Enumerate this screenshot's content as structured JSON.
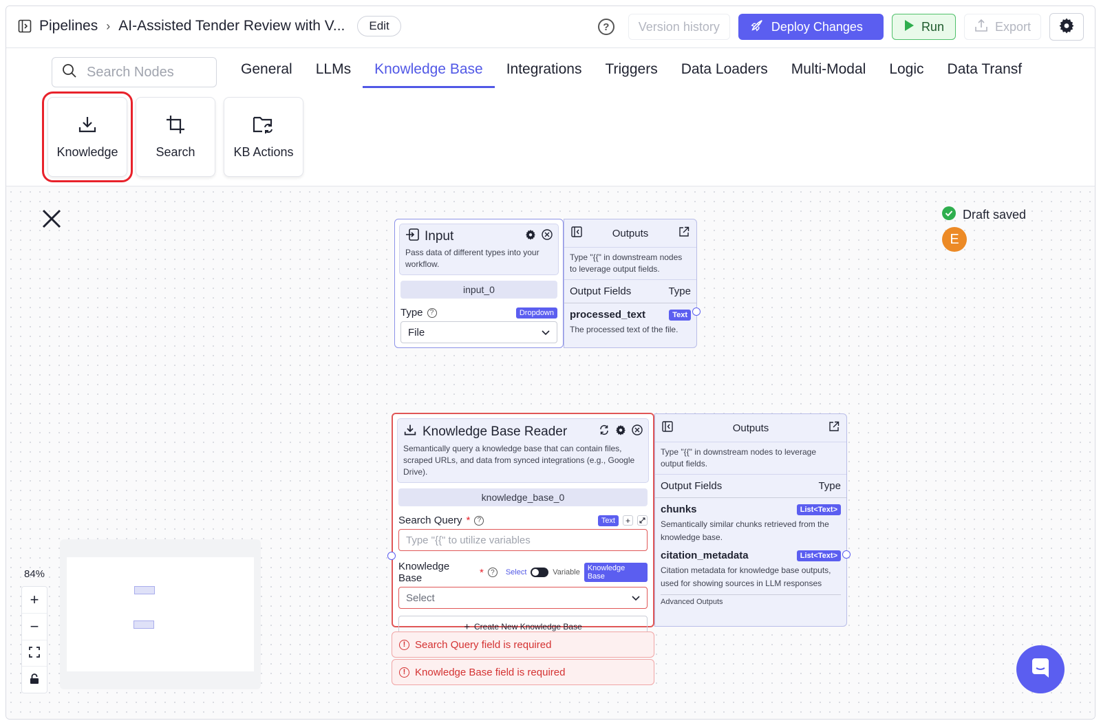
{
  "header": {
    "breadcrumb_root": "Pipelines",
    "breadcrumb_sep": "›",
    "pipeline_name": "AI-Assisted Tender Review with V...",
    "edit_label": "Edit",
    "help_glyph": "?",
    "version_history": "Version history",
    "deploy": "Deploy Changes",
    "run": "Run",
    "export": "Export"
  },
  "palette": {
    "search_placeholder": "Search Nodes",
    "tabs": [
      "General",
      "LLMs",
      "Knowledge Base",
      "Integrations",
      "Triggers",
      "Data Loaders",
      "Multi-Modal",
      "Logic",
      "Data Transf"
    ],
    "active_tab": "Knowledge Base",
    "cards": [
      {
        "label": "Knowledge",
        "icon": "download-icon"
      },
      {
        "label": "Search",
        "icon": "crop-icon"
      },
      {
        "label": "KB Actions",
        "icon": "folder-sync-icon"
      }
    ]
  },
  "canvas": {
    "draft_status": "Draft saved",
    "avatar_initial": "E",
    "zoom": "84%",
    "zoom_in": "+",
    "zoom_out": "−"
  },
  "input_node": {
    "title": "Input",
    "description": "Pass data of different types into your workflow.",
    "name": "input_0",
    "type_label": "Type",
    "type_chip": "Dropdown",
    "type_value": "File",
    "outputs_title": "Outputs",
    "outputs_hint": "Type \"{{\" in downstream nodes to leverage output fields.",
    "output_fields_label": "Output Fields",
    "type_col_label": "Type",
    "fields": [
      {
        "name": "processed_text",
        "type": "Text",
        "desc": "The processed text of the file."
      }
    ]
  },
  "kb_node": {
    "title": "Knowledge Base Reader",
    "description": "Semantically query a knowledge base that can contain files, scraped URLs, and data from synced integrations (e.g., Google Drive).",
    "name": "knowledge_base_0",
    "search_query_label": "Search Query",
    "required_mark": "*",
    "search_query_chip": "Text",
    "search_query_placeholder": "Type \"{{\" to utilize variables",
    "kb_label": "Knowledge Base",
    "toggle_left": "Select",
    "toggle_right": "Variable",
    "kb_chip": "Knowledge Base",
    "kb_select_value": "Select",
    "create_new": "Create New Knowledge Base",
    "outputs_title": "Outputs",
    "outputs_hint": "Type \"{{\" in downstream nodes to leverage output fields.",
    "output_fields_label": "Output Fields",
    "type_col_label": "Type",
    "fields": [
      {
        "name": "chunks",
        "type": "List<Text>",
        "desc": "Semantically similar chunks retrieved from the knowledge base."
      },
      {
        "name": "citation_metadata",
        "type": "List<Text>",
        "desc": "Citation metadata for knowledge base outputs, used for showing sources in LLM responses"
      }
    ],
    "advanced_outputs": "Advanced Outputs"
  },
  "errors": [
    "Search Query field is required",
    "Knowledge Base field is required"
  ],
  "colors": {
    "accent": "#5b5ef0",
    "run_green": "#4fc06a",
    "error_red": "#e05656",
    "highlight_red": "#e8222b",
    "avatar_orange": "#ec8a26"
  }
}
